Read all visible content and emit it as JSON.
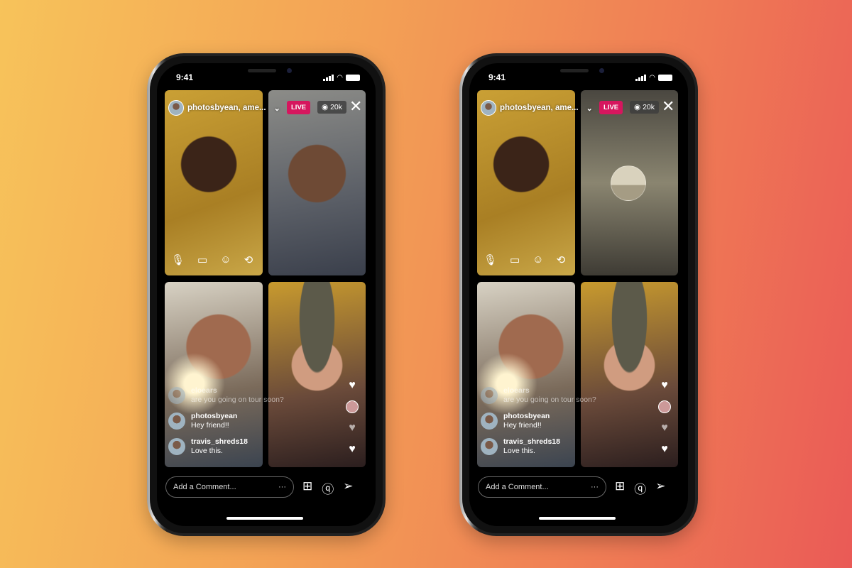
{
  "phones": [
    {
      "time": "9:41",
      "host": "photosbyean, ame...",
      "live_label": "LIVE",
      "viewers": "20k",
      "top_right_mode": "video",
      "comments": [
        {
          "user": "eloears",
          "text": "are you going on tour soon?",
          "faded": true
        },
        {
          "user": "photosbyean",
          "text": "Hey friend!!",
          "faded": false
        },
        {
          "user": "travis_shreds18",
          "text": "Love this.",
          "faded": false
        }
      ],
      "comment_placeholder": "Add a Comment...",
      "more": "···"
    },
    {
      "time": "9:41",
      "host": "photosbyean, ame...",
      "live_label": "LIVE",
      "viewers": "20k",
      "top_right_mode": "audio-only",
      "comments": [
        {
          "user": "eloears",
          "text": "are you going on tour soon?",
          "faded": true
        },
        {
          "user": "photosbyean",
          "text": "Hey friend!!",
          "faded": false
        },
        {
          "user": "travis_shreds18",
          "text": "Love this.",
          "faded": false
        }
      ],
      "comment_placeholder": "Add a Comment...",
      "more": "···"
    }
  ],
  "colors": {
    "live_badge": "#d6165e"
  },
  "icons": {
    "controls": [
      "microphone-icon",
      "video-camera-icon",
      "face-effects-icon",
      "flip-camera-icon"
    ],
    "actions": [
      "add-video-guest-icon",
      "question-icon",
      "send-direct-icon"
    ]
  }
}
